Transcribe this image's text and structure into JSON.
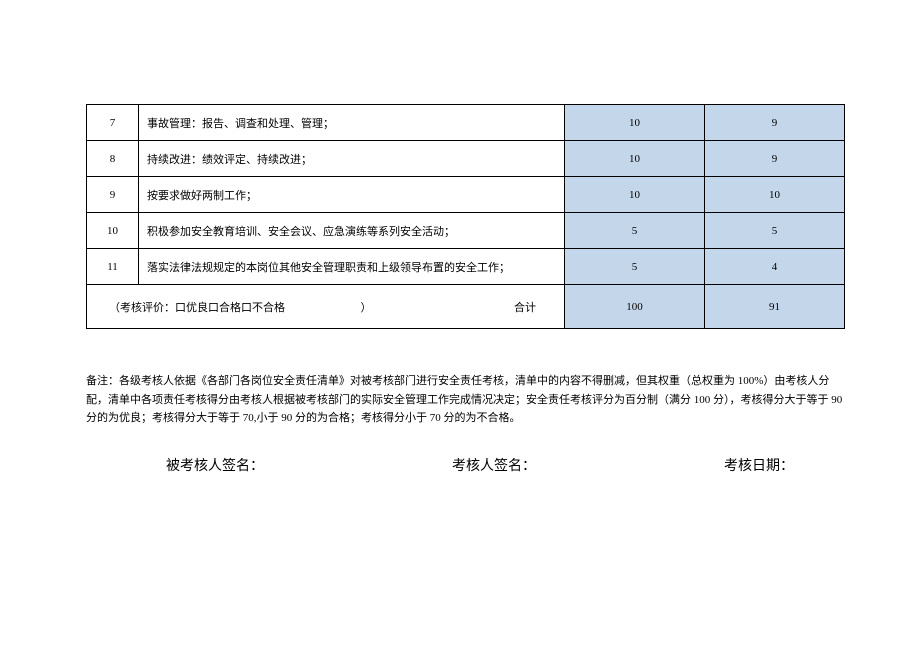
{
  "table": {
    "rows": [
      {
        "num": "7",
        "desc": "事故管理：报告、调查和处理、管理；",
        "weight": "10",
        "score": "9"
      },
      {
        "num": "8",
        "desc": "持续改进：绩效评定、持续改进；",
        "weight": "10",
        "score": "9"
      },
      {
        "num": "9",
        "desc": "按要求做好两制工作；",
        "weight": "10",
        "score": "10"
      },
      {
        "num": "10",
        "desc": "积极参加安全教育培训、安全会议、应急演练等系列安全活动；",
        "weight": "5",
        "score": "5"
      },
      {
        "num": "11",
        "desc": "落实法律法规规定的本岗位其他安全管理职责和上级领导布置的安全工作；",
        "weight": "5",
        "score": "4"
      }
    ],
    "summary": {
      "label": "（考核评价：口优良口合格口不合格",
      "paren": "）",
      "heji": "合计",
      "totalWeight": "100",
      "totalScore": "91"
    }
  },
  "notes": {
    "text": "备注：各级考核人依据《各部门各岗位安全责任清单》对被考核部门进行安全责任考核，清单中的内容不得删减，但其权重（总权重为 100%）由考核人分配，清单中各项责任考核得分由考核人根据被考核部门的实际安全管理工作完成情况决定；安全责任考核评分为百分制（满分 100 分），考核得分大于等于 90 分的为优良；考核得分大于等于 70,小于 90 分的为合格；考核得分小于 70 分的为不合格。"
  },
  "signatures": {
    "examinee": "被考核人签名：",
    "examiner": "考核人签名：",
    "date": "考核日期："
  }
}
